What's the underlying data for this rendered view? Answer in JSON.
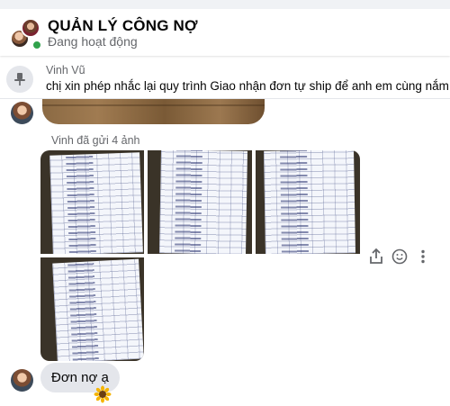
{
  "header": {
    "title": "QUẢN LÝ CÔNG NỢ",
    "status": "Đang hoạt động"
  },
  "pinned": {
    "sender": "Vinh Vũ",
    "text": "chị xin phép nhắc lại quy trình Giao nhận đơn tự ship để anh em cùng nắm"
  },
  "messages": {
    "sent_label": "Vinh đã gửi 4 ảnh",
    "photo_count": 4,
    "bubble_text": "Đơn nợ ạ",
    "reaction": "sunflower"
  },
  "icons": {
    "pin": "pin-icon",
    "share": "share-icon",
    "emoji": "emoji-icon",
    "more": "more-vertical-icon"
  },
  "colors": {
    "online": "#31a24c",
    "bubble": "#e4e6eb",
    "muted_text": "#65676b"
  }
}
